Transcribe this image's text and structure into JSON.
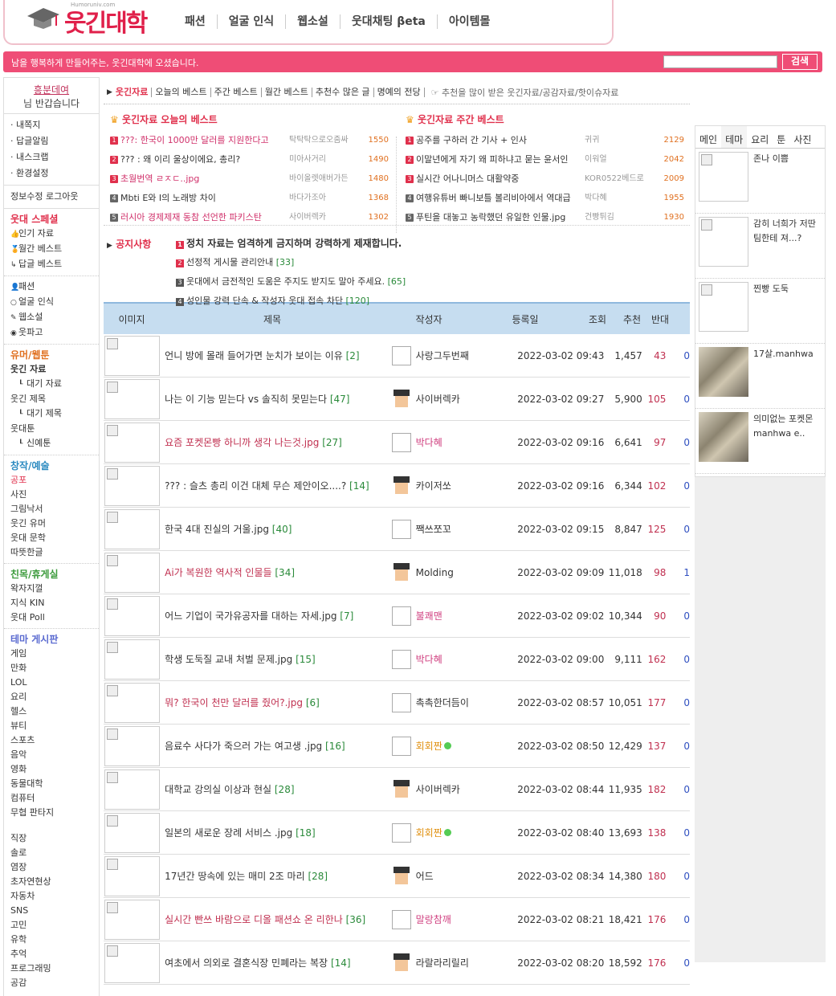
{
  "header": {
    "logo_text": "웃긴대학",
    "logo_url": "Humoruniv.com",
    "nav": [
      "패션",
      "얼굴 인식",
      "웹소설",
      "웃대채팅 βeta",
      "아이템몰"
    ]
  },
  "welcome": {
    "message": "남을 행복하게 만들어주는, 웃긴대학에 오셨습니다.",
    "search_placeholder": "",
    "search_label": "검색"
  },
  "sidebar": {
    "user_name": "흥분데여",
    "greeting": "님 반갑습니다",
    "links": [
      "· 내쪽지",
      "· 답글알림",
      "· 내스크랩",
      "· 환경설정"
    ],
    "logout": "정보수정 로그아웃",
    "special_title": "웃대 스페셜",
    "special": [
      "인기 자료",
      "월간 베스트",
      "답글 베스트"
    ],
    "fun": [
      "패션",
      "얼굴 인식",
      "웹소설",
      "웃파고"
    ],
    "humor_title": "유머/웹툰",
    "humor": [
      "웃긴 자료",
      "대기 자료",
      "웃긴 제목",
      "대기 제목",
      "웃대툰",
      "신예툰"
    ],
    "create_title": "창작/예술",
    "create": [
      "공포",
      "사진",
      "그림낙서",
      "웃긴 유머",
      "웃대 문학",
      "따뜻한글"
    ],
    "social_title": "친목/휴게실",
    "social": [
      "왁자지껄",
      "지식 KIN",
      "웃대 Poll"
    ],
    "theme_title": "테마 게시판",
    "theme": [
      "게임",
      "만화",
      "LOL",
      "요리",
      "헬스",
      "뷰티",
      "스포츠",
      "음악",
      "영화",
      "동물대학",
      "컴퓨터",
      "무협 판타지"
    ],
    "theme2": [
      "직장",
      "솔로",
      "염장",
      "초자연현상",
      "자동차",
      "SNS",
      "고민",
      "유학",
      "추억",
      "프로그래밍",
      "공감"
    ]
  },
  "catbar": {
    "items": [
      "웃긴자료",
      "오늘의 베스트",
      "주간 베스트",
      "월간 베스트",
      "추천수 많은 글",
      "명예의 전당"
    ],
    "tip": "☞ 추천을 많이 받은 웃긴자료/공감자료/핫이슈자료"
  },
  "best_today": {
    "title": "웃긴자료 오늘의 베스트",
    "rows": [
      {
        "num": "1",
        "title": "???: 한국이 1000만 달러를 지원한다고",
        "author": "탁탁탁으로오줌싸",
        "count": "1550"
      },
      {
        "num": "2",
        "title": "??? : 왜 이리 울상이에요, 총리?",
        "author": "미아사거리",
        "count": "1490"
      },
      {
        "num": "3",
        "title": "초월번역 ㄹㅈㄷ..jpg",
        "author": "바이올렛애버가든",
        "count": "1480"
      },
      {
        "num": "4",
        "title": "Mbti E와 I의 노래방 차이",
        "author": "바다가조아",
        "count": "1368"
      },
      {
        "num": "5",
        "title": "러시아 경제제재 동참 선언한 파키스탄",
        "author": "사이버렉카",
        "count": "1302"
      }
    ]
  },
  "best_week": {
    "title": "웃긴자료 주간 베스트",
    "rows": [
      {
        "num": "1",
        "title": "공주를 구하러 간 기사 + 인사",
        "author": "귀귀",
        "count": "2129"
      },
      {
        "num": "2",
        "title": "이말년에게 자기 왜 피하냐고 묻는 윤서인",
        "author": "이워얼",
        "count": "2042"
      },
      {
        "num": "3",
        "title": "실시간 어나니머스 대활약중",
        "author": "KOR0522베드로",
        "count": "2009"
      },
      {
        "num": "4",
        "title": "여행유튜버 빠니보틀 볼리비아에서 역대급",
        "author": "박다혜",
        "count": "1955"
      },
      {
        "num": "5",
        "title": "푸틴을 대놓고 농락했던 유일한 인물.jpg",
        "author": "건빵튀김",
        "count": "1930"
      }
    ]
  },
  "notice": {
    "label": "공지사항",
    "rows": [
      {
        "num": "1",
        "text": "정치 자료는 엄격하게 금지하며 강력하게 제재합니다.",
        "cmt": ""
      },
      {
        "num": "2",
        "text": "선정적 게시물 관리안내",
        "cmt": "[33]"
      },
      {
        "num": "3",
        "text": "웃대에서 금전적인 도움은 주지도 받지도 말아 주세요.",
        "cmt": "[65]"
      },
      {
        "num": "4",
        "text": "성인물 강력 단속 & 작성자 웃대 접속 차단",
        "cmt": "[120]"
      }
    ]
  },
  "table": {
    "headers": [
      "이미지",
      "제목",
      "작성자",
      "등록일",
      "조회",
      "추천",
      "반대"
    ],
    "rows": [
      {
        "title": "언니 방에 몰래 들어가면 눈치가 보이는 이유",
        "cmt": "[2]",
        "writer": "사랑그두번째",
        "date": "2022-03-02 09:43",
        "views": "1,457",
        "rec": "43",
        "down": "0"
      },
      {
        "title": "나는 이 기능 믿는다 vs 솔직히 못믿는다",
        "cmt": "[47]",
        "writer": "사이버렉카",
        "date": "2022-03-02 09:27",
        "views": "5,900",
        "rec": "105",
        "down": "0"
      },
      {
        "title": "요즘 포켓몬빵 하니까 생각 나는것.jpg",
        "cmt": "[27]",
        "writer": "박다혜",
        "date": "2022-03-02 09:16",
        "views": "6,641",
        "rec": "97",
        "down": "0"
      },
      {
        "title": "??? : 슬츠 총리 이건 대체 무슨 제안이오....?",
        "cmt": "[14]",
        "writer": "카이저쏘",
        "date": "2022-03-02 09:16",
        "views": "6,344",
        "rec": "102",
        "down": "0"
      },
      {
        "title": "한국 4대 진실의 거울.jpg",
        "cmt": "[40]",
        "writer": "짹쓰쪼꼬",
        "date": "2022-03-02 09:15",
        "views": "8,847",
        "rec": "125",
        "down": "0"
      },
      {
        "title": "Ai가 복원한 역사적 인물들",
        "cmt": "[34]",
        "writer": "Molding",
        "date": "2022-03-02 09:09",
        "views": "11,018",
        "rec": "98",
        "down": "1"
      },
      {
        "title": "어느 기업이 국가유공자를 대하는 자세.jpg",
        "cmt": "[7]",
        "writer": "불쾌맨",
        "date": "2022-03-02 09:02",
        "views": "10,344",
        "rec": "90",
        "down": "0"
      },
      {
        "title": "학생 도둑질 교내 처벌 문제.jpg",
        "cmt": "[15]",
        "writer": "박다혜",
        "date": "2022-03-02 09:00",
        "views": "9,111",
        "rec": "162",
        "down": "0"
      },
      {
        "title": "뭐? 한국이 천만 달러를 줬어?.jpg",
        "cmt": "[6]",
        "writer": "촉촉한더듬이",
        "date": "2022-03-02 08:57",
        "views": "10,051",
        "rec": "177",
        "down": "0"
      },
      {
        "title": "음료수 사다가 죽으러 가는 여고생 .jpg",
        "cmt": "[16]",
        "writer": "회회짠",
        "date": "2022-03-02 08:50",
        "views": "12,429",
        "rec": "137",
        "down": "0"
      },
      {
        "title": "대학교 강의실 이상과 현실",
        "cmt": "[28]",
        "writer": "사이버렉카",
        "date": "2022-03-02 08:44",
        "views": "11,935",
        "rec": "182",
        "down": "0"
      },
      {
        "title": "일본의 새로운 장례 서비스 .jpg",
        "cmt": "[18]",
        "writer": "회회짠",
        "date": "2022-03-02 08:40",
        "views": "13,693",
        "rec": "138",
        "down": "0"
      },
      {
        "title": "17년간 땅속에 있는 매미 2조 마리",
        "cmt": "[28]",
        "writer": "어드",
        "date": "2022-03-02 08:34",
        "views": "14,380",
        "rec": "180",
        "down": "0"
      },
      {
        "title": "실시간 빤쓰 바람으로 디올 패션쇼 온 리한나",
        "cmt": "[36]",
        "writer": "말랑참깨",
        "date": "2022-03-02 08:21",
        "views": "18,421",
        "rec": "176",
        "down": "0"
      },
      {
        "title": "여초에서 의외로 결혼식장 민폐라는 복장",
        "cmt": "[14]",
        "writer": "라랄라리릴리",
        "date": "2022-03-02 08:20",
        "views": "18,592",
        "rec": "176",
        "down": "0"
      }
    ]
  },
  "right": {
    "tabs": [
      "메인",
      "테마",
      "요리",
      "툰",
      "사진"
    ],
    "items": [
      "존나 이쁨",
      "감히 너희가 저딴 팀한테 져...?",
      "찐빵 도둑",
      "17살.manhwa",
      "의미없는 포켓몬 manhwa e.."
    ]
  }
}
